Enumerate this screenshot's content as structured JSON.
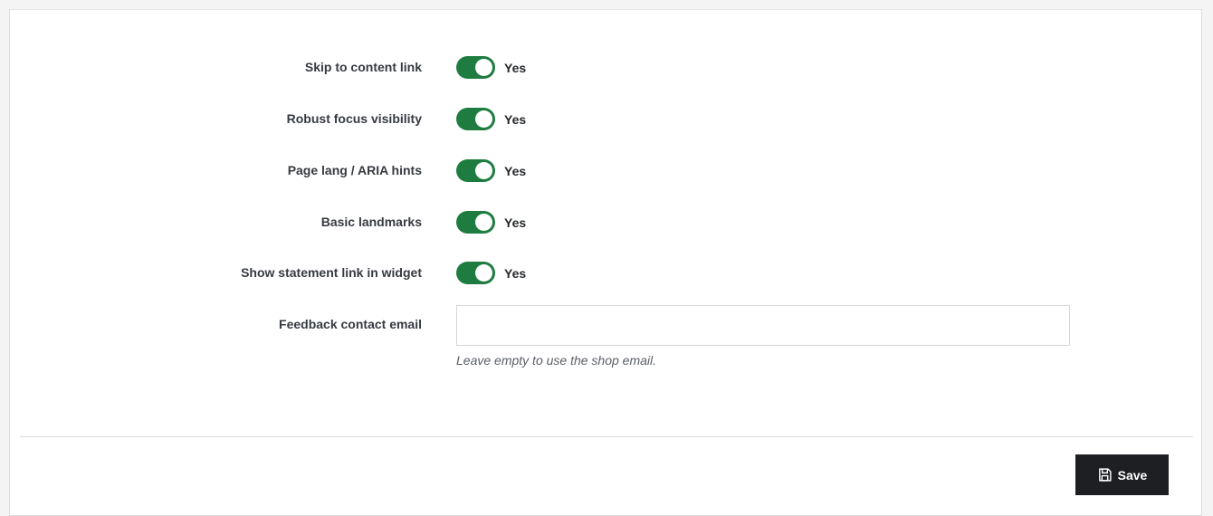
{
  "form": {
    "heading_clipped": "",
    "toggles": [
      {
        "label": "Skip to content link",
        "value": "Yes"
      },
      {
        "label": "Robust focus visibility",
        "value": "Yes"
      },
      {
        "label": "Page lang / ARIA hints",
        "value": "Yes"
      },
      {
        "label": "Basic landmarks",
        "value": "Yes"
      },
      {
        "label": "Show statement link in widget",
        "value": "Yes"
      }
    ],
    "email": {
      "label": "Feedback contact email",
      "value": "",
      "placeholder": "",
      "help": "Leave empty to use the shop email."
    }
  },
  "footer": {
    "save_label": "Save",
    "save_icon": "save-icon"
  },
  "colors": {
    "toggle_on": "#1e7c40",
    "button_bg": "#1d1f22"
  }
}
